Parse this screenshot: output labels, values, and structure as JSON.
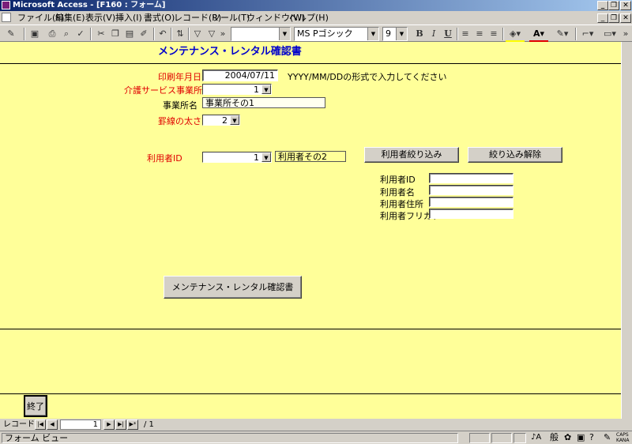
{
  "window": {
    "title": "Microsoft Access - [F160 : フォーム]",
    "minimize": "_",
    "restore": "❐",
    "close": "✕"
  },
  "menu": [
    "ファイル(F)",
    "編集(E)",
    "表示(V)",
    "挿入(I)",
    "書式(O)",
    "レコード(R)",
    "ツール(T)",
    "ウィンドウ(W)",
    "ヘルプ(H)"
  ],
  "toolbar": {
    "object_combo": "",
    "font_name": "MS Pゴシック",
    "font_size": "9",
    "bold": "B",
    "italic": "I",
    "underline": "U"
  },
  "form": {
    "title": "メンテナンス・レンタル確認書",
    "print_date_label": "印刷年月日",
    "print_date_value": "2004/07/11",
    "date_hint": "YYYY/MM/DDの形式で入力してください",
    "office_label": "介護サービス事業所",
    "office_value": "1",
    "office_name_label": "事業所名",
    "office_name_value": "事業所その1",
    "line_width_label": "罫線の太さ",
    "line_width_value": "2",
    "user_id_label": "利用者ID",
    "user_id_value": "1",
    "user_name_value": "利用者その2",
    "filter_button": "利用者絞り込み",
    "clear_filter_button": "絞り込み解除",
    "filter_fields": [
      {
        "label": "利用者ID",
        "value": ""
      },
      {
        "label": "利用者名",
        "value": ""
      },
      {
        "label": "利用者住所",
        "value": ""
      },
      {
        "label": "利用者フリガナ",
        "value": ""
      }
    ],
    "report_button": "メンテナンス・レンタル確認書",
    "exit_button": "終了"
  },
  "nav": {
    "label": "レコード:",
    "record_number": "1",
    "total": "/ 1"
  },
  "status": {
    "text": "フォーム ビュー",
    "ime": "般",
    "caps": "CAPS",
    "kana": "KANA"
  }
}
